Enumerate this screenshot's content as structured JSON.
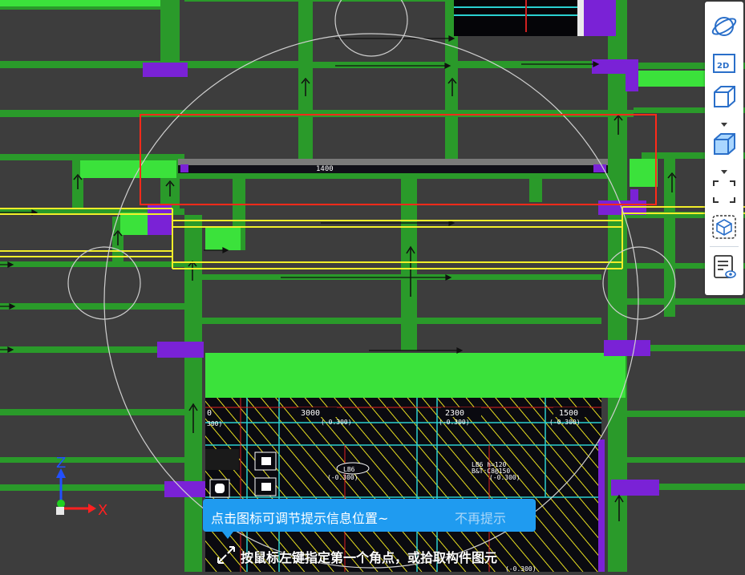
{
  "viewport": {
    "name": "cad-3d-model-view",
    "colors": {
      "background": "#3d3d3d",
      "beam": "#2a9a2a",
      "slab_edge": "#3be23b",
      "column": "#7a22d6",
      "selection_box": "#ff2a1a",
      "highlight_beam": "#f2ee2a",
      "guide_circle": "#cfcfcf"
    },
    "drawing_labels": {
      "dim_1400": "1400",
      "dim_3000": "3000",
      "dim_2300": "2300",
      "dim_1500": "1500",
      "elev_a": "(-0.300)",
      "elev_b": "(-0.300)",
      "elev_c": "(-0.300)",
      "elev_d": "(-0.300)",
      "elev_e": "(-0.300)",
      "elev_f": "(-0.300)",
      "lb_tag": "LB6",
      "lb_spec": "LB6 h=120",
      "lb_rebar": "B&T:C8@150",
      "dim_left": "0",
      "elev_left": "300)"
    }
  },
  "toolbar": {
    "items": [
      {
        "name": "orbit-icon",
        "title": "orbit"
      },
      {
        "name": "view-2d-icon",
        "label": "2D"
      },
      {
        "name": "wireframe-cube-icon"
      },
      {
        "name": "solid-cube-icon"
      },
      {
        "name": "dashed-selection-icon"
      },
      {
        "name": "dashed-cube-icon"
      },
      {
        "name": "property-view-icon"
      }
    ]
  },
  "axis_gizmo": {
    "x_label": "X",
    "z_label": "Z"
  },
  "hint": {
    "message": "点击图标可调节提示信息位置~",
    "dismiss": "不再提示"
  },
  "status": {
    "prompt": "按鼠标左键指定第一个角点，或拾取构件图元"
  }
}
